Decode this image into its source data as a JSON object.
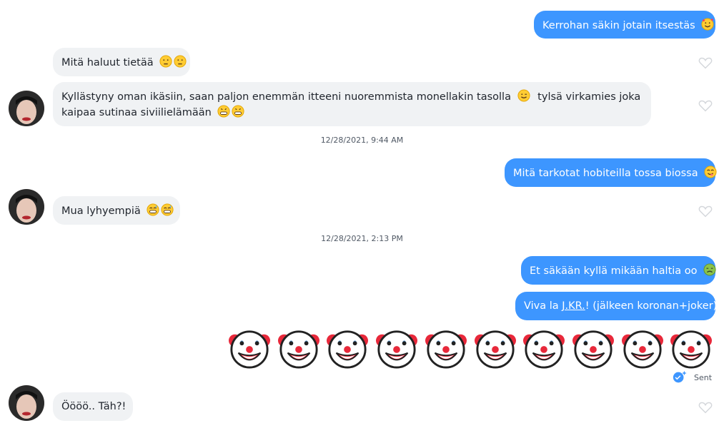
{
  "messages": {
    "m1": "Kerrohan säkin jotain itsestäs",
    "m2": "Mitä haluut tietää",
    "m3_line1": "Kyllästyny oman ikäsiin, saan paljon enemmän itteeni nuoremmista monellakin tasolla",
    "m3_line1b": "tylsä virkamies joka",
    "m3_line2": "kaipaa sutinaa siviilielämään",
    "m4": "Mitä tarkotat hobiteilla tossa biossa",
    "m5": "Mua lyhyempiä",
    "m6": "Et säkään kyllä mikään haltia oo",
    "m7_pre": "Viva la ",
    "m7_link": "J.KR.",
    "m7_post": "! (jälkeen koronan+joker)",
    "m8": "Öööö.. Täh?!"
  },
  "timestamps": {
    "t1": "12/28/2021, 9:44 AM",
    "t2": "12/28/2021, 2:13 PM"
  },
  "status": {
    "sent_label": "Sent"
  },
  "colors": {
    "outgoing": "#3d96ff",
    "incoming": "#f0f2f4",
    "heart": "#d4d7db"
  },
  "icons": [
    "smiling-face-with-hearts-emoji",
    "thinking-face-emoji",
    "winking-face-emoji",
    "grinning-face-emoji",
    "grinning-sweat-face-emoji",
    "savoring-food-face-emoji",
    "nauseated-face-emoji",
    "clown-face-emoji",
    "heart-icon",
    "sent-check-icon"
  ]
}
